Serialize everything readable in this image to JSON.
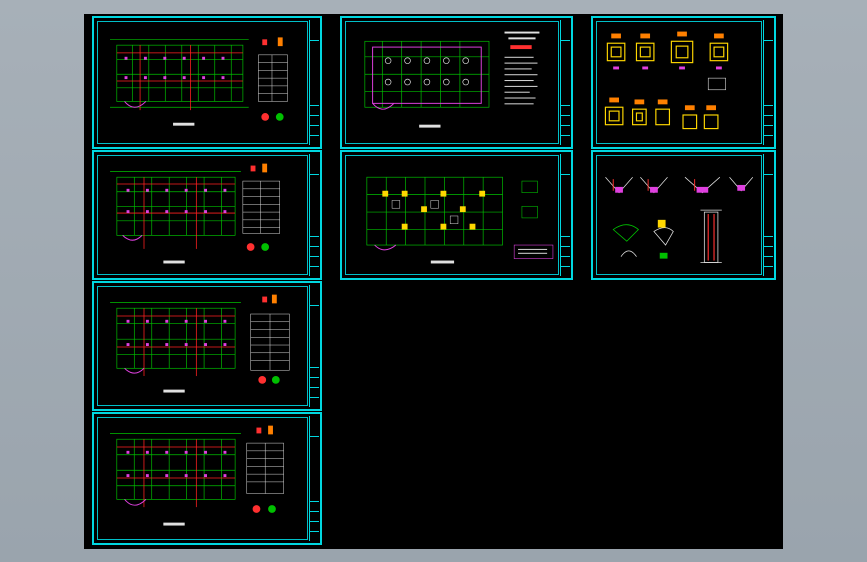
{
  "viewer": {
    "background_color": "#9ea8b1",
    "canvas_color": "#000000",
    "accent_frame": "#00d7e0"
  },
  "sheets": [
    {
      "id": "sheet-1",
      "kind": "plan-with-table"
    },
    {
      "id": "sheet-2",
      "kind": "plan-with-table"
    },
    {
      "id": "sheet-3",
      "kind": "plan-with-table"
    },
    {
      "id": "sheet-4",
      "kind": "plan-with-table"
    },
    {
      "id": "sheet-5",
      "kind": "plan-with-notes"
    },
    {
      "id": "sheet-6",
      "kind": "plan-with-legend"
    },
    {
      "id": "sheet-7",
      "kind": "pile-cap-details"
    },
    {
      "id": "sheet-8",
      "kind": "section-details"
    }
  ]
}
